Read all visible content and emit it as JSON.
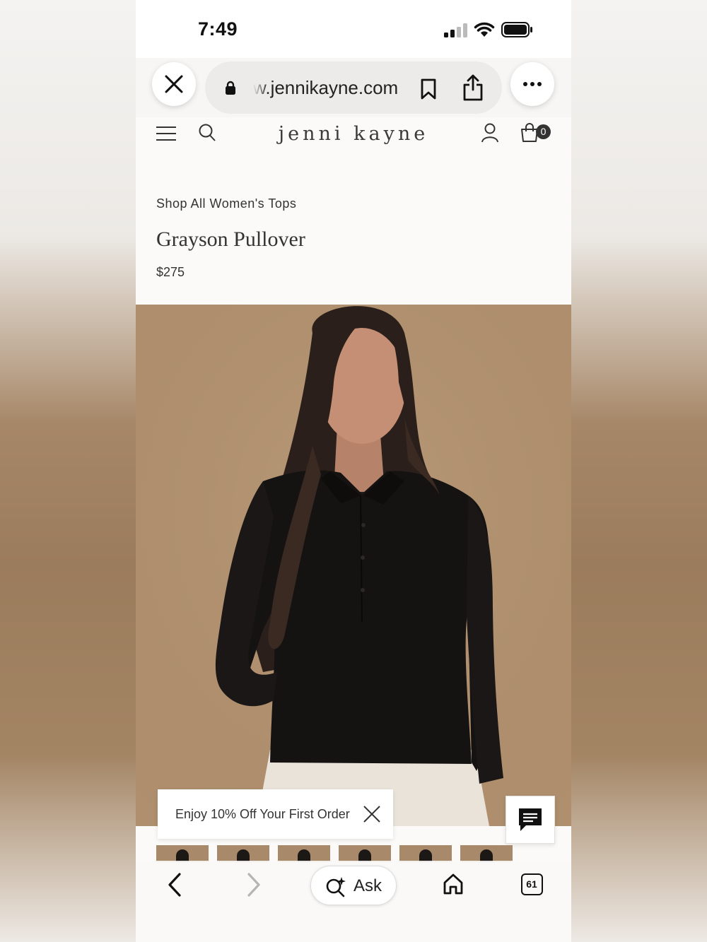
{
  "status_bar": {
    "time": "7:49"
  },
  "browser": {
    "url": "w.jennikayne.com"
  },
  "site": {
    "logo": "jenni kayne",
    "cart_count": "0"
  },
  "product": {
    "breadcrumb": "Shop All Women's Tops",
    "title": "Grayson Pullover",
    "price": "$275"
  },
  "promo": {
    "text": "Enjoy 10% Off Your First Order"
  },
  "bottom_bar": {
    "ask_label": "Ask",
    "tabs_count": "61"
  },
  "colors": {
    "image_background": "#b0906e",
    "page_background": "#fbfaf8",
    "sweater": "#151312"
  },
  "thumbnail_count": 6
}
